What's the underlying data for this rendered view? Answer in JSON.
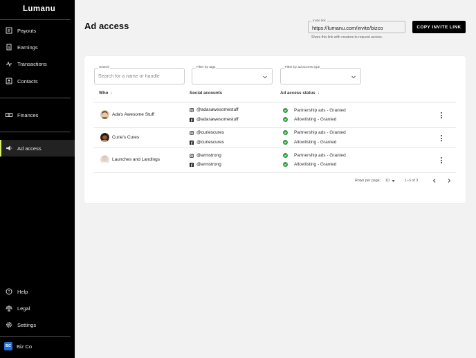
{
  "app": {
    "logo": "Lumanu"
  },
  "sidebar": {
    "items": [
      {
        "label": "Payouts",
        "icon": "payouts-icon"
      },
      {
        "label": "Earnings",
        "icon": "earnings-icon"
      },
      {
        "label": "Transactions",
        "icon": "transactions-icon"
      },
      {
        "label": "Contacts",
        "icon": "contacts-icon"
      },
      {
        "label": "Finances",
        "icon": "finances-icon"
      },
      {
        "label": "Ad access",
        "icon": "megaphone-icon",
        "active": true
      },
      {
        "label": "Help",
        "icon": "help-icon"
      },
      {
        "label": "Legal",
        "icon": "legal-icon"
      },
      {
        "label": "Settings",
        "icon": "gear-icon"
      }
    ],
    "profile": {
      "initials": "BC",
      "name": "Biz Co"
    }
  },
  "header": {
    "title": "Ad access",
    "invite": {
      "label": "Invite link",
      "value": "https://lumanu.com/invite/bizco",
      "help": "Share this link with creators to request access."
    },
    "copy_button": "COPY INVITE LINK"
  },
  "filters": {
    "search": {
      "label": "Search",
      "placeholder": "Search for a name or handle"
    },
    "tags": {
      "label": "Filter by tags",
      "value": ""
    },
    "ad_type": {
      "label": "Filter by ad access type",
      "value": ""
    }
  },
  "table": {
    "columns": [
      "Who",
      "Social accounts",
      "Ad access status"
    ],
    "rows": [
      {
        "name": "Ada's Awesome Stuff",
        "instagram": "@adasawesomestuff",
        "facebook": "@adasawesomestuff",
        "status": [
          "Partnership ads - Granted",
          "Allowlisting - Granted"
        ]
      },
      {
        "name": "Curie's Cures",
        "instagram": "@curiescures",
        "facebook": "@curiescures",
        "status": [
          "Partnership ads - Granted",
          "Allowlisting - Granted"
        ]
      },
      {
        "name": "Launches and Landings",
        "instagram": "@armstrong",
        "facebook": "@armstrong",
        "status": [
          "Partnership ads - Granted",
          "Allowlisting - Granted"
        ]
      }
    ]
  },
  "pagination": {
    "rows_label": "Rows per page:",
    "rows_value": "10",
    "range": "1–3 of 3"
  },
  "colors": {
    "sidebar_bg": "#000000",
    "active_accent": "#d4f06a",
    "granted_green": "#2e9d3e",
    "profile_blue": "#1e6fd9"
  }
}
